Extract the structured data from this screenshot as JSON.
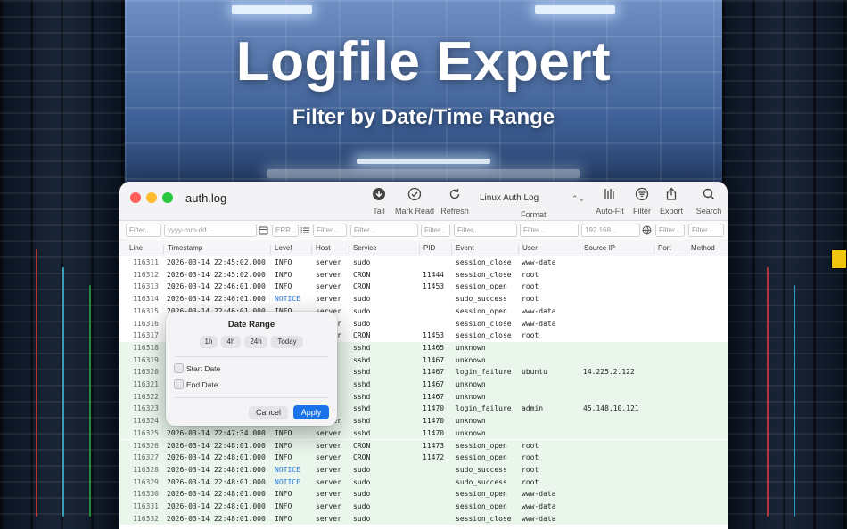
{
  "marketing": {
    "headline": "Logfile Expert",
    "subheadline": "Filter by Date/Time Range"
  },
  "window": {
    "title": "auth.log",
    "toolbar": {
      "tail": "Tail",
      "mark_read": "Mark Read",
      "refresh": "Refresh",
      "format_value": "Linux Auth Log",
      "format_label": "Format",
      "auto_fit": "Auto-Fit",
      "filter": "Filter",
      "export": "Export",
      "search": "Search"
    }
  },
  "filters": {
    "line": "Filter...",
    "timestamp": "yyyy-mm-dd...",
    "level": "ERR...",
    "host": "Filter...",
    "service": "Filter...",
    "pid": "Filter...",
    "event": "Filter...",
    "user": "Filter...",
    "source_ip": "192.168...",
    "port": "Filter...",
    "method": "Filter..."
  },
  "columns": {
    "line": "Line",
    "timestamp": "Timestamp",
    "level": "Level",
    "host": "Host",
    "service": "Service",
    "pid": "PID",
    "event": "Event",
    "user": "User",
    "source_ip": "Source IP",
    "port": "Port",
    "method": "Method"
  },
  "rows": [
    {
      "line": "116311",
      "ts": "2026-03-14 22:45:02.000",
      "level": "INFO",
      "host": "server",
      "service": "sudo",
      "pid": "",
      "event": "session_close",
      "user": "www-data",
      "ip": "",
      "highlight": false
    },
    {
      "line": "116312",
      "ts": "2026-03-14 22:45:02.000",
      "level": "INFO",
      "host": "server",
      "service": "CRON",
      "pid": "11444",
      "event": "session_close",
      "user": "root",
      "ip": "",
      "highlight": false
    },
    {
      "line": "116313",
      "ts": "2026-03-14 22:46:01.000",
      "level": "INFO",
      "host": "server",
      "service": "CRON",
      "pid": "11453",
      "event": "session_open",
      "user": "root",
      "ip": "",
      "highlight": false
    },
    {
      "line": "116314",
      "ts": "2026-03-14 22:46:01.000",
      "level": "NOTICE",
      "host": "server",
      "service": "sudo",
      "pid": "",
      "event": "sudo_success",
      "user": "root",
      "ip": "",
      "highlight": false
    },
    {
      "line": "116315",
      "ts": "2026-03-14 22:46:01.000",
      "level": "INFO",
      "host": "server",
      "service": "sudo",
      "pid": "",
      "event": "session_open",
      "user": "www-data",
      "ip": "",
      "highlight": false
    },
    {
      "line": "116316",
      "ts": "",
      "level": "",
      "host": "server",
      "service": "sudo",
      "pid": "",
      "event": "session_close",
      "user": "www-data",
      "ip": "",
      "highlight": false
    },
    {
      "line": "116317",
      "ts": "",
      "level": "",
      "host": "server",
      "service": "CRON",
      "pid": "11453",
      "event": "session_close",
      "user": "root",
      "ip": "",
      "highlight": false
    },
    {
      "line": "116318",
      "ts": "",
      "level": "",
      "host": "",
      "service": "sshd",
      "pid": "11465",
      "event": "unknown",
      "user": "",
      "ip": "",
      "highlight": true
    },
    {
      "line": "116319",
      "ts": "",
      "level": "",
      "host": "",
      "service": "sshd",
      "pid": "11467",
      "event": "unknown",
      "user": "",
      "ip": "",
      "highlight": true
    },
    {
      "line": "116320",
      "ts": "",
      "level": "",
      "host": "",
      "service": "sshd",
      "pid": "11467",
      "event": "login_failure",
      "user": "ubuntu",
      "ip": "14.225.2.122",
      "highlight": true
    },
    {
      "line": "116321",
      "ts": "",
      "level": "",
      "host": "",
      "service": "sshd",
      "pid": "11467",
      "event": "unknown",
      "user": "",
      "ip": "",
      "highlight": true
    },
    {
      "line": "116322",
      "ts": "",
      "level": "",
      "host": "",
      "service": "sshd",
      "pid": "11467",
      "event": "unknown",
      "user": "",
      "ip": "",
      "highlight": true
    },
    {
      "line": "116323",
      "ts": "",
      "level": "",
      "host": "",
      "service": "sshd",
      "pid": "11470",
      "event": "login_failure",
      "user": "admin",
      "ip": "45.148.10.121",
      "highlight": true
    },
    {
      "line": "116324",
      "ts": "",
      "level": "",
      "host": "server",
      "service": "sshd",
      "pid": "11470",
      "event": "unknown",
      "user": "",
      "ip": "",
      "highlight": true
    },
    {
      "line": "116325",
      "ts": "2026-03-14 22:47:34.000",
      "level": "INFO",
      "host": "server",
      "service": "sshd",
      "pid": "11470",
      "event": "unknown",
      "user": "",
      "ip": "",
      "highlight": true
    },
    {
      "line": "116326",
      "ts": "2026-03-14 22:48:01.000",
      "level": "INFO",
      "host": "server",
      "service": "CRON",
      "pid": "11473",
      "event": "session_open",
      "user": "root",
      "ip": "",
      "highlight": true
    },
    {
      "line": "116327",
      "ts": "2026-03-14 22:48:01.000",
      "level": "INFO",
      "host": "server",
      "service": "CRON",
      "pid": "11472",
      "event": "session_open",
      "user": "root",
      "ip": "",
      "highlight": true
    },
    {
      "line": "116328",
      "ts": "2026-03-14 22:48:01.000",
      "level": "NOTICE",
      "host": "server",
      "service": "sudo",
      "pid": "",
      "event": "sudo_success",
      "user": "root",
      "ip": "",
      "highlight": true
    },
    {
      "line": "116329",
      "ts": "2026-03-14 22:48:01.000",
      "level": "NOTICE",
      "host": "server",
      "service": "sudo",
      "pid": "",
      "event": "sudo_success",
      "user": "root",
      "ip": "",
      "highlight": true
    },
    {
      "line": "116330",
      "ts": "2026-03-14 22:48:01.000",
      "level": "INFO",
      "host": "server",
      "service": "sudo",
      "pid": "",
      "event": "session_open",
      "user": "www-data",
      "ip": "",
      "highlight": true
    },
    {
      "line": "116331",
      "ts": "2026-03-14 22:48:01.000",
      "level": "INFO",
      "host": "server",
      "service": "sudo",
      "pid": "",
      "event": "session_open",
      "user": "www-data",
      "ip": "",
      "highlight": true
    },
    {
      "line": "116332",
      "ts": "2026-03-14 22:48:01.000",
      "level": "INFO",
      "host": "server",
      "service": "sudo",
      "pid": "",
      "event": "session_close",
      "user": "www-data",
      "ip": "",
      "highlight": true
    }
  ],
  "date_range_popover": {
    "title": "Date Range",
    "quick_ranges": [
      "1h",
      "4h",
      "24h",
      "Today"
    ],
    "start_label": "Start Date",
    "end_label": "End Date",
    "cancel": "Cancel",
    "apply": "Apply"
  },
  "colors": {
    "accent": "#1a73e8",
    "notice": "#2a7bde",
    "highlight_row": "#eaf6ec"
  }
}
